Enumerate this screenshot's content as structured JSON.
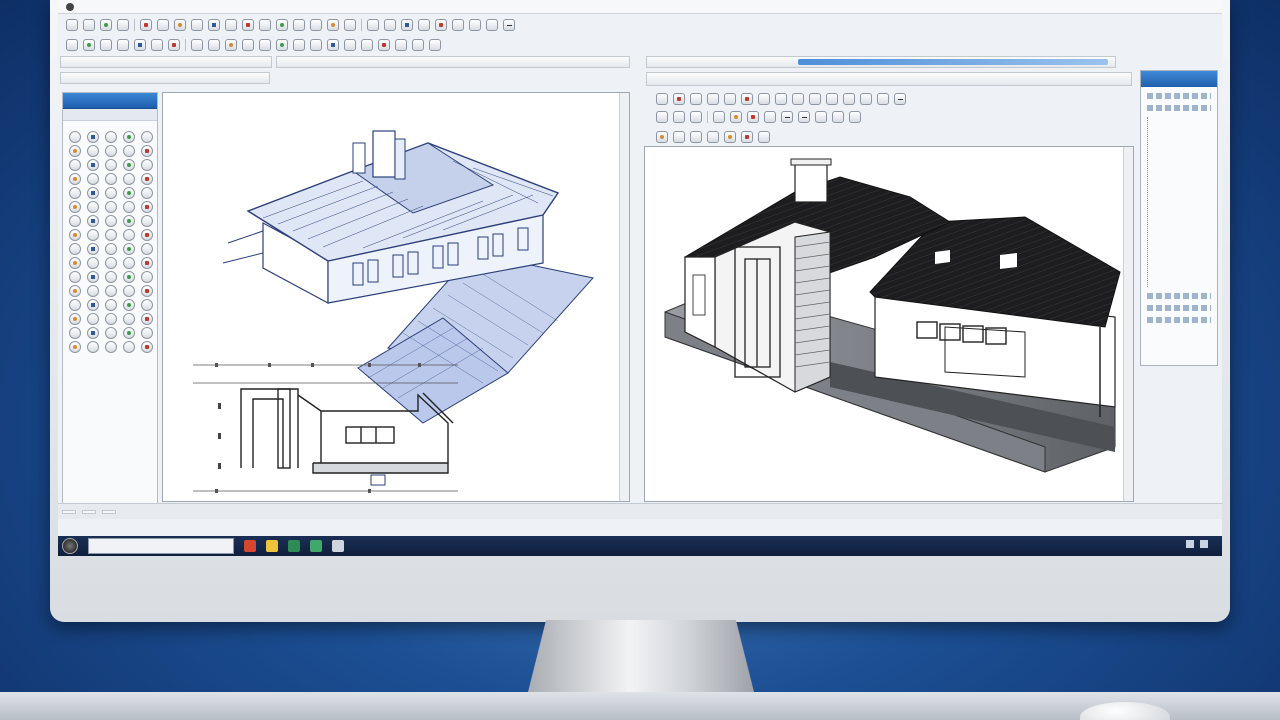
{
  "menu": {
    "items": [
      "",
      "",
      "",
      "",
      "",
      "",
      "",
      "",
      "",
      "",
      "",
      "",
      "",
      "",
      ""
    ]
  },
  "left_panel": {
    "tabs": [
      "",
      "",
      "",
      "",
      ""
    ]
  },
  "viewport_left": {
    "label": ""
  },
  "viewport_right": {
    "label": ""
  },
  "bottom_tabs": [
    "",
    "",
    ""
  ],
  "taskbar": {
    "search_placeholder": "",
    "tray_text": "",
    "task_colors": [
      "#d7462f",
      "#f0c33c",
      "#2e8b57",
      "#3fa86a",
      "#d0d6df"
    ]
  },
  "colors": {
    "blueprint_line": "#2b3f7a",
    "blueprint_fill": "#c7d3ee",
    "roof_dark": "#1d1d1f",
    "wall_white": "#ffffff",
    "panel_accent": "#1e5fae"
  }
}
